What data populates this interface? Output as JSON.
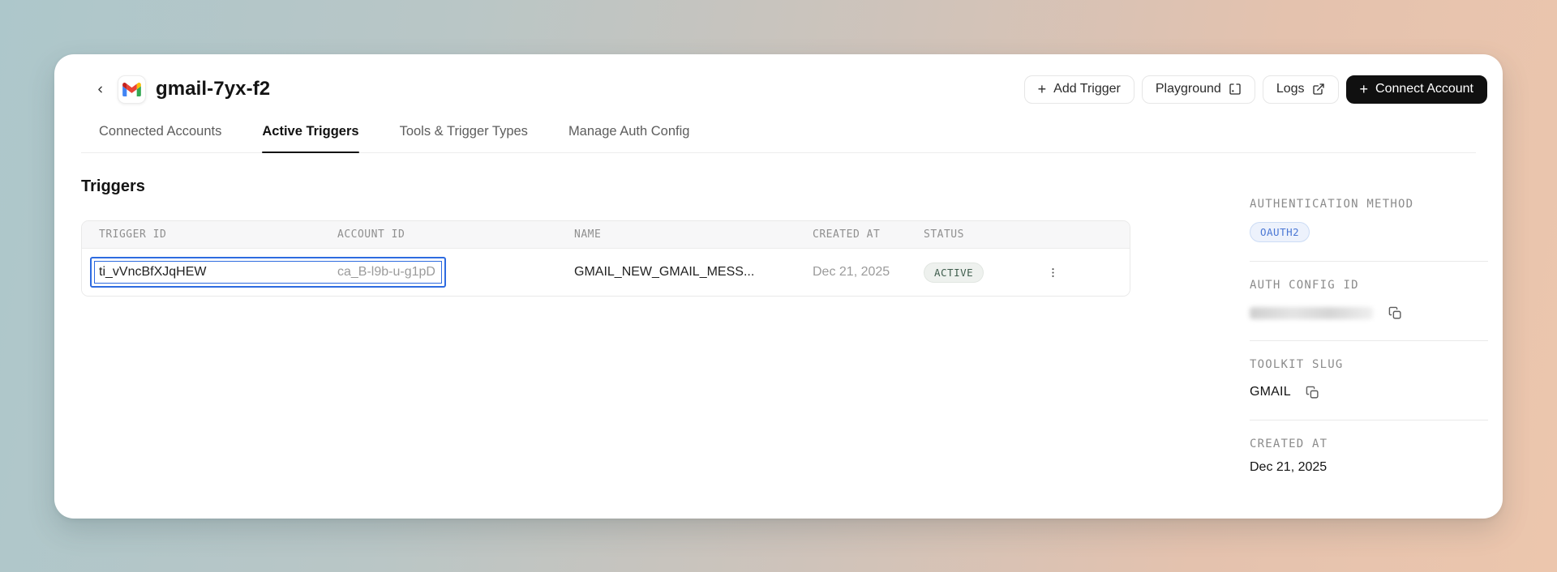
{
  "header": {
    "app_title": "gmail-7yx-f2",
    "buttons": {
      "add_trigger": "Add Trigger",
      "playground": "Playground",
      "logs": "Logs",
      "connect_account": "Connect Account"
    }
  },
  "tabs": [
    {
      "label": "Connected Accounts",
      "active": false
    },
    {
      "label": "Active Triggers",
      "active": true
    },
    {
      "label": "Tools & Trigger Types",
      "active": false
    },
    {
      "label": "Manage Auth Config",
      "active": false
    }
  ],
  "main": {
    "section_title": "Triggers",
    "table": {
      "columns": [
        "TRIGGER ID",
        "ACCOUNT ID",
        "NAME",
        "CREATED AT",
        "STATUS"
      ],
      "rows": [
        {
          "trigger_id": "ti_vVncBfXJqHEW",
          "account_id": "ca_B-l9b-u-g1pD",
          "name": "GMAIL_NEW_GMAIL_MESS...",
          "created_at": "Dec 21, 2025",
          "status": "ACTIVE"
        }
      ]
    }
  },
  "sidebar": {
    "auth_method_label": "AUTHENTICATION METHOD",
    "auth_method_badge": "OAUTH2",
    "auth_config_label": "AUTH CONFIG ID",
    "auth_config_value": "",
    "toolkit_label": "TOOLKIT SLUG",
    "toolkit_value": "GMAIL",
    "created_label": "CREATED AT",
    "created_value": "Dec 21, 2025"
  },
  "colors": {
    "accent_selection": "#2e6be0",
    "status_active_text": "#3f5d4d",
    "status_active_bg": "#eef1ee",
    "oauth_badge_text": "#4a77d4",
    "oauth_badge_bg": "#edf2fc",
    "dark_button_bg": "#101010",
    "bg_gradient_left": "#adc7cb",
    "bg_gradient_right": "#ecc6ad"
  }
}
